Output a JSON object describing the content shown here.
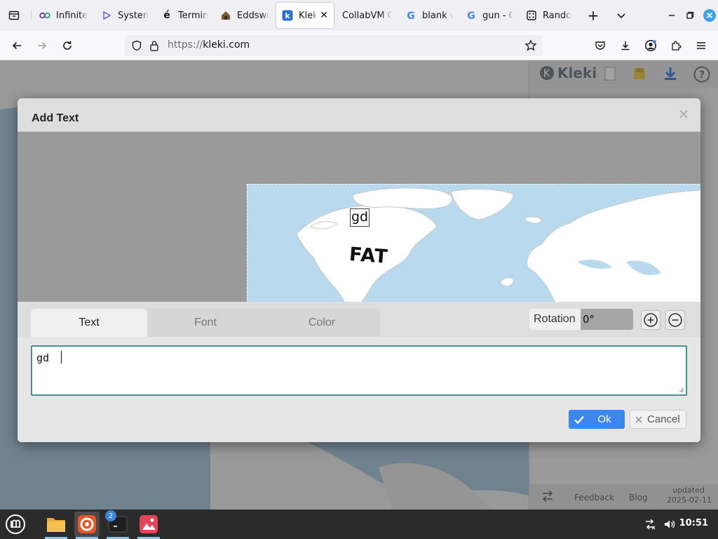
{
  "browser": {
    "tabs": [
      {
        "label": "Infinite",
        "icon": "infinite-icon",
        "active": false
      },
      {
        "label": "System",
        "icon": "play-icon",
        "active": false
      },
      {
        "label": "Termin",
        "icon": "e-accent-icon",
        "active": false
      },
      {
        "label": "Eddswo",
        "icon": "house-icon",
        "active": false
      },
      {
        "label": "Kleki",
        "icon": "kleki-icon",
        "active": true
      },
      {
        "label": "CollabVM C",
        "icon": "none",
        "active": false
      },
      {
        "label": "blank w",
        "icon": "google-icon",
        "active": false
      },
      {
        "label": "gun - G",
        "icon": "google-icon",
        "active": false
      },
      {
        "label": "Rando",
        "icon": "dice-icon",
        "active": false
      }
    ],
    "tab_close_glyph": "✕",
    "new_tab_glyph": "+",
    "url_scheme": "https://",
    "url_host": "kleki.com"
  },
  "app": {
    "name": "Kleki",
    "footer": {
      "feedback": "Feedback",
      "blog": "Blog",
      "updated_label": "updated",
      "updated_date": "2025-02-11"
    }
  },
  "dialog": {
    "title": "Add Text",
    "close_glyph": "×",
    "preview_text": "gd",
    "canvas_drawn_text": "FAT",
    "tabs": [
      {
        "label": "Text",
        "active": true
      },
      {
        "label": "Font",
        "active": false
      },
      {
        "label": "Color",
        "active": false
      }
    ],
    "rotation": {
      "label": "Rotation",
      "value": "0°"
    },
    "text_value": "gd ",
    "ok_label": "Ok",
    "cancel_label": "Cancel"
  },
  "taskbar": {
    "terminal_badge": "2",
    "clock": "10:51"
  },
  "colors": {
    "accent_blue": "#3d86f0",
    "textarea_border": "#4a8f98",
    "dialog_bg": "#dedede",
    "canvas_water": "#b9daee"
  }
}
